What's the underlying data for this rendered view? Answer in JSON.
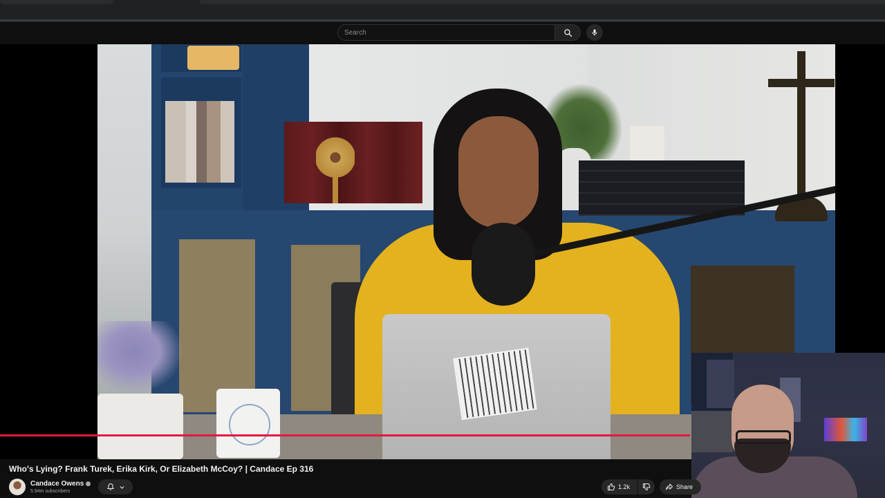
{
  "header": {
    "search_placeholder": "Search",
    "search_icon": "search-icon",
    "mic_icon": "mic-icon"
  },
  "player": {
    "progress": 0.78,
    "progress_color": "#e5173f"
  },
  "video": {
    "title": "Who's Lying? Frank Turek, Erika Kirk, Or Elizabeth McCoy? | Candace Ep 316"
  },
  "channel": {
    "name": "Candace Owens",
    "subscribers": "5.94m subscribers",
    "verified_icon": "verified-icon",
    "bell_icon": "bell-icon",
    "chevron_icon": "chevron-down-icon"
  },
  "actions": {
    "like_count": "1.2k",
    "share_label": "Share",
    "like_icon": "thumbs-up-icon",
    "dislike_icon": "thumbs-down-icon",
    "share_icon": "share-icon"
  }
}
